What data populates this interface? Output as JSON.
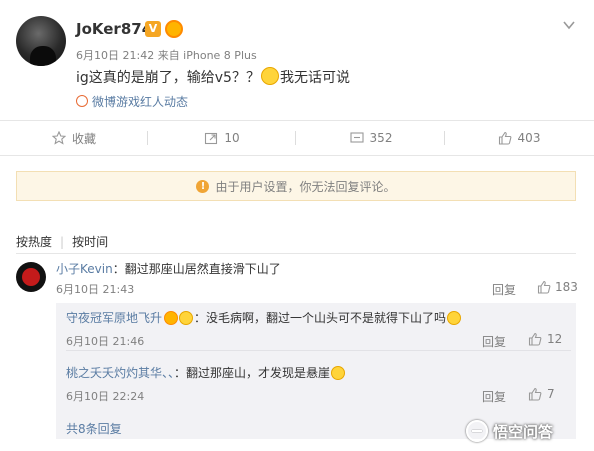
{
  "post": {
    "username": "JoKer874",
    "vip_badge": "V",
    "meta": "6月10日 21:42 来自 iPhone 8 Plus",
    "text_before_emoji": "ig这真的是崩了，输给v5？？",
    "text_after_emoji": "我无话可说",
    "source": "微博游戏红人动态"
  },
  "actions": {
    "favorite": "收藏",
    "repost_count": "10",
    "comment_count": "352",
    "like_count": "403"
  },
  "notice": "由于用户设置，你无法回复评论。",
  "sort": {
    "hot": "按热度",
    "time": "按时间"
  },
  "comment": {
    "nick": "小子Kevin",
    "text": "：翻过那座山居然直接滑下山了",
    "time": "6月10日 21:43",
    "reply_label": "回复",
    "likes": "183"
  },
  "replies": [
    {
      "nick": "守夜冠军原地飞升",
      "text": "：没毛病啊，翻过一个山头可不是就得下山了吗",
      "time": "6月10日 21:46",
      "reply_label": "回复",
      "likes": "12"
    },
    {
      "nick": "桃之夭夭灼灼其华、、",
      "text": "：翻过那座山，才发现是悬崖",
      "time": "6月10日 22:24",
      "reply_label": "回复",
      "likes": "7"
    }
  ],
  "total_replies": "共8条回复",
  "watermark": "悟空问答",
  "colors": {
    "link": "#5a7ca3",
    "notice_bg": "#fdf6e6",
    "badge": "#f5a623"
  }
}
